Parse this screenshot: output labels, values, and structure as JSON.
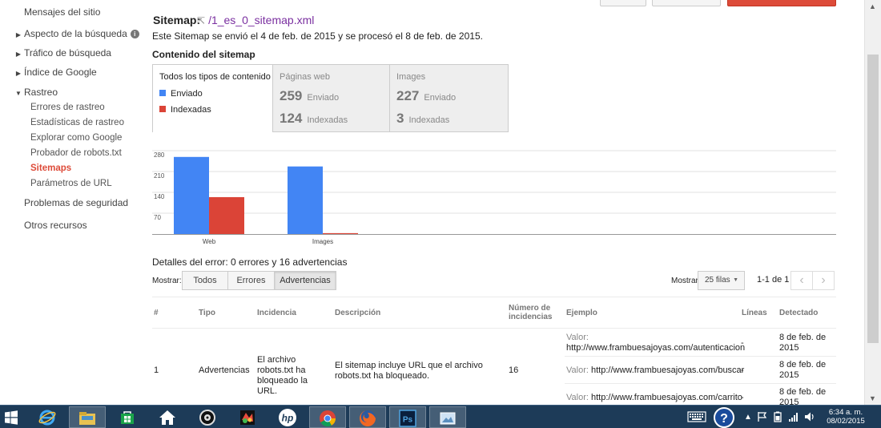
{
  "sidebar": {
    "items": [
      {
        "label": "Mensajes del sitio"
      },
      {
        "label": "Aspecto de la búsqueda"
      },
      {
        "label": "Tráfico de búsqueda"
      },
      {
        "label": "Índice de Google"
      },
      {
        "label": "Rastreo"
      },
      {
        "label": "Errores de rastreo"
      },
      {
        "label": "Estadísticas de rastreo"
      },
      {
        "label": "Explorar como Google"
      },
      {
        "label": "Probador de robots.txt"
      },
      {
        "label": "Sitemaps"
      },
      {
        "label": "Parámetros de URL"
      },
      {
        "label": "Problemas de seguridad"
      },
      {
        "label": "Otros recursos"
      }
    ],
    "info_glyph": "i"
  },
  "sitemap": {
    "title_label": "Sitemap:",
    "filename": "/1_es_0_sitemap.xml",
    "description": "Este Sitemap se envió el 4 de feb. de 2015 y se procesó el 8 de feb. de 2015.",
    "content_title": "Contenido del sitemap"
  },
  "content_tabs": {
    "all": {
      "label": "Todos los tipos de contenido",
      "legend_sent": "Enviado",
      "legend_indexed": "Indexadas"
    },
    "web": {
      "label": "Páginas web",
      "sent_value": "259",
      "sent_label": "Enviado",
      "indexed_value": "124",
      "indexed_label": "Indexadas"
    },
    "images": {
      "label": "Images",
      "sent_value": "227",
      "sent_label": "Enviado",
      "indexed_value": "3",
      "indexed_label": "Indexadas"
    }
  },
  "colors": {
    "sent": "#4285f4",
    "indexed": "#db4437",
    "active_nav": "#dd4b39"
  },
  "chart_data": {
    "type": "bar",
    "categories": [
      "Web",
      "Images"
    ],
    "series": [
      {
        "name": "Enviado",
        "values": [
          259,
          227
        ]
      },
      {
        "name": "Indexadas",
        "values": [
          124,
          3
        ]
      }
    ],
    "yticks": [
      70,
      140,
      210,
      280
    ],
    "ylim": [
      0,
      280
    ],
    "grid": true,
    "title": "",
    "xlabel": "",
    "ylabel": ""
  },
  "errors": {
    "title": "Detalles del error: 0 errores y 16 advertencias",
    "show_label": "Mostrar:",
    "filters": [
      "Todos",
      "Errores",
      "Advertencias"
    ],
    "rows_label": "Mostrar",
    "rows_value": "25 filas",
    "pagination": "1-1 de 1"
  },
  "table": {
    "headers": {
      "num": "#",
      "type": "Tipo",
      "issue": "Incidencia",
      "description": "Descripción",
      "count_l1": "Número de",
      "count_l2": "incidencias",
      "example": "Ejemplo",
      "lines": "Líneas",
      "detected": "Detectado"
    },
    "row": {
      "num": "1",
      "type": "Advertencias",
      "issue": "El archivo robots.txt ha bloqueado la URL.",
      "description": "El sitemap incluye URL que el archivo robots.txt ha bloqueado.",
      "count": "16"
    },
    "examples": [
      {
        "label": "Valor:",
        "url": "http://www.frambuesajoyas.com/autenticacion",
        "lines": "-",
        "detected": "8 de feb. de 2015"
      },
      {
        "label": "Valor:",
        "url": "http://www.frambuesajoyas.com/buscar",
        "lines": "-",
        "detected": "8 de feb. de 2015"
      },
      {
        "label": "Valor:",
        "url": "http://www.frambuesajoyas.com/carrito",
        "lines": "-",
        "detected": "8 de feb. de 2015"
      }
    ]
  },
  "taskbar": {
    "time": "6:34 a. m.",
    "date": "08/02/2015",
    "apps": [
      "windows-start",
      "internet-explorer",
      "file-explorer",
      "store",
      "home",
      "media-player",
      "paint-app",
      "hp",
      "chrome",
      "firefox",
      "photoshop",
      "picture-app"
    ]
  }
}
